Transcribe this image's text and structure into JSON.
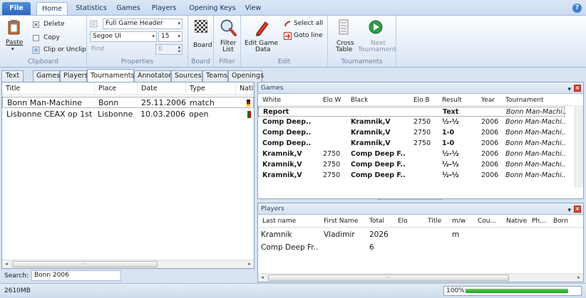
{
  "ribbon_tabs": [
    "File",
    "Home",
    "Statistics",
    "Games",
    "Players",
    "Opening Keys",
    "View"
  ],
  "clipboard": {
    "paste": "Paste",
    "delete": "Delete",
    "copy": "Copy",
    "clip": "Clip or Unclip",
    "title": "Clipboard"
  },
  "properties": {
    "header_combo": "Full Game Header",
    "font_combo": "Segoe UI",
    "size_combo": "15",
    "first_label": "First",
    "first_value": "0",
    "title": "Properties"
  },
  "board_group": {
    "board": "Board",
    "title": "Board"
  },
  "filter_group": {
    "filter_list": "Filter\nList",
    "filter_line1": "Filter",
    "filter_line2": "List",
    "title": "Filter"
  },
  "edit_group": {
    "edit_line1": "Edit Game",
    "edit_line2": "Data",
    "select_all": "Select all",
    "goto_line": "Goto line",
    "title": "Edit"
  },
  "tournaments_group": {
    "cross_line1": "Cross",
    "cross_line2": "Table",
    "next_line1": "Next",
    "next_line2": "Tournament",
    "title": "Tournaments"
  },
  "doc_tabs": [
    "Text",
    "Games",
    "Players",
    "Tournaments",
    "Annotator",
    "Sources",
    "Teams",
    "Openings"
  ],
  "tournament_list": {
    "columns": [
      "Title",
      "Place",
      "Date",
      "Type",
      "Nati"
    ],
    "rows": [
      {
        "title": "Bonn Man-Machine",
        "place": "Bonn",
        "date": "25.11.2006",
        "type": "match"
      },
      {
        "title": "Lisbonne CEAX op 1st",
        "place": "Lisbonne",
        "date": "10.03.2006",
        "type": "open"
      }
    ]
  },
  "search": {
    "label": "Search:",
    "value": "Bonn 2006"
  },
  "games_panel": {
    "title": "Games",
    "columns": [
      "White",
      "Elo W",
      "Black",
      "Elo B",
      "Result",
      "Year",
      "Tournament"
    ],
    "rows": [
      {
        "white": "Report",
        "elo_w": "",
        "black": "",
        "elo_b": "",
        "result": "Text",
        "year": "",
        "tournament": "Bonn Man-Machi.."
      },
      {
        "white": "Comp Deep..",
        "elo_w": "",
        "black": "Kramnik,V",
        "elo_b": "2750",
        "result": "½-½",
        "year": "2006",
        "tournament": "Bonn Man-Machi.."
      },
      {
        "white": "Comp Deep..",
        "elo_w": "",
        "black": "Kramnik,V",
        "elo_b": "2750",
        "result": "1-0",
        "year": "2006",
        "tournament": "Bonn Man-Machi.."
      },
      {
        "white": "Comp Deep..",
        "elo_w": "",
        "black": "Kramnik,V",
        "elo_b": "2750",
        "result": "1-0",
        "year": "2006",
        "tournament": "Bonn Man-Machi.."
      },
      {
        "white": "Kramnik,V",
        "elo_w": "2750",
        "black": "Comp Deep F..",
        "elo_b": "",
        "result": "½-½",
        "year": "2006",
        "tournament": "Bonn Man-Machi.."
      },
      {
        "white": "Kramnik,V",
        "elo_w": "2750",
        "black": "Comp Deep F..",
        "elo_b": "",
        "result": "½-½",
        "year": "2006",
        "tournament": "Bonn Man-Machi.."
      },
      {
        "white": "Kramnik,V",
        "elo_w": "2750",
        "black": "Comp Deep F..",
        "elo_b": "",
        "result": "½-½",
        "year": "2006",
        "tournament": "Bonn Man-Machi.."
      }
    ]
  },
  "players_panel": {
    "title": "Players",
    "columns": [
      "Last name",
      "First Name",
      "Total",
      "Elo",
      "Title",
      "m/w",
      "Cou...",
      "Native",
      "Ph...",
      "Born"
    ],
    "rows": [
      {
        "last": "Kramnik",
        "first": "Vladimir",
        "total": "2026",
        "mw": "m"
      },
      {
        "last": "Comp Deep Fr..",
        "first": "",
        "total": "6",
        "mw": ""
      }
    ]
  },
  "status": {
    "memory": "2610MB",
    "zoom": "100%",
    "progress_fraction": 0.9
  },
  "colors": {
    "accent": "#2b64b8",
    "progress": "#1f9d1f"
  },
  "icons": [
    "help-icon",
    "paste-icon",
    "delete-icon",
    "copy-icon",
    "clip-icon",
    "board-icon",
    "filter-list-icon",
    "edit-game-data-icon",
    "select-all-icon",
    "goto-line-icon",
    "cross-table-icon",
    "next-tournament-icon",
    "close-icon",
    "dropdown-icon"
  ]
}
